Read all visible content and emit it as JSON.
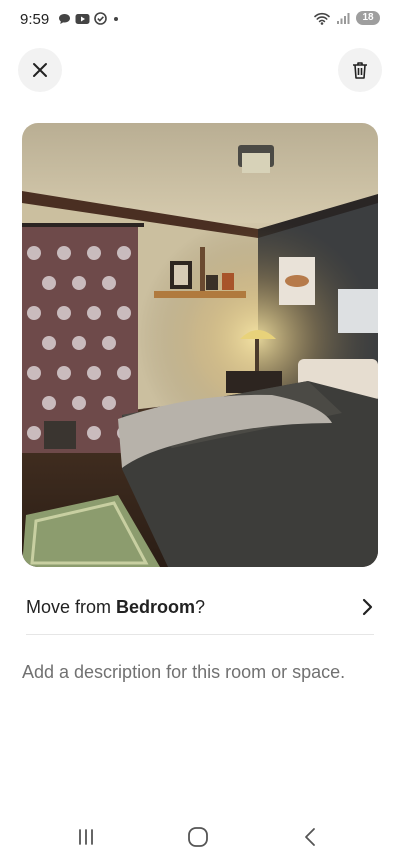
{
  "status": {
    "time": "9:59",
    "battery": "18"
  },
  "move": {
    "prefix": "Move from ",
    "room": "Bedroom",
    "suffix": "?"
  },
  "description": {
    "placeholder": "Add a description for this room or space."
  },
  "icons": {
    "close": "close-icon",
    "delete": "trash-icon",
    "chevron": "chevron-right-icon",
    "nav": [
      "recents-icon",
      "home-icon",
      "back-icon"
    ]
  }
}
